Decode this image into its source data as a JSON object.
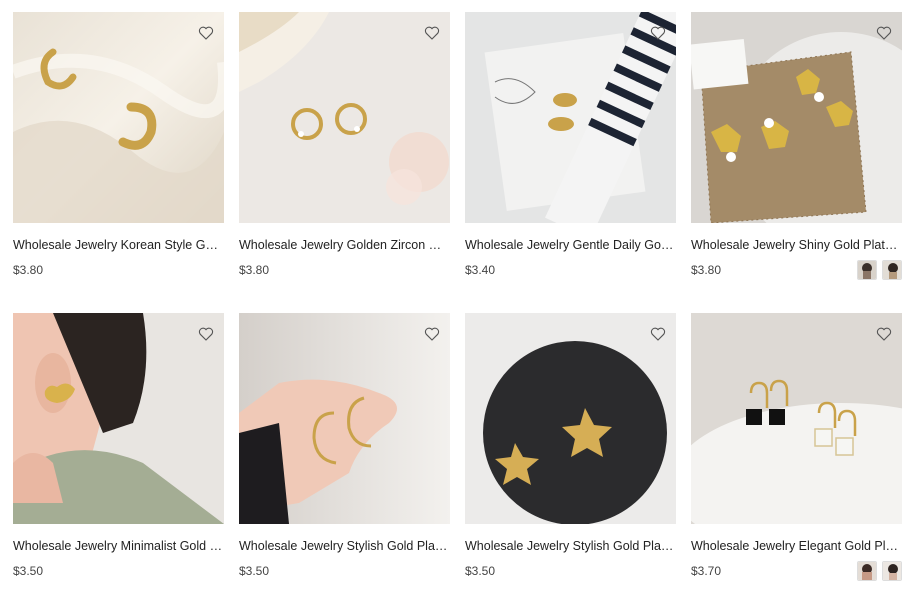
{
  "products": [
    {
      "title": "Wholesale Jewelry Korean Style Gold Plated Earrings",
      "price": "$3.80",
      "favorite_icon": "heart-outline-icon",
      "swatches": []
    },
    {
      "title": "Wholesale Jewelry Golden Zircon Crystal Hoop Earrings",
      "price": "$3.80",
      "favorite_icon": "heart-outline-icon",
      "swatches": []
    },
    {
      "title": "Wholesale Jewelry Gentle Daily Gold Leaf Earrings",
      "price": "$3.40",
      "favorite_icon": "heart-outline-icon",
      "swatches": []
    },
    {
      "title": "Wholesale Jewelry Shiny Gold Plated Heart Earrings",
      "price": "$3.80",
      "favorite_icon": "heart-outline-icon",
      "swatches": [
        "variant-1",
        "variant-2"
      ]
    },
    {
      "title": "Wholesale Jewelry Minimalist Gold Heart Earrings",
      "price": "$3.50",
      "favorite_icon": "heart-outline-icon",
      "swatches": []
    },
    {
      "title": "Wholesale Jewelry Stylish Gold Plated Moon Earrings",
      "price": "$3.50",
      "favorite_icon": "heart-outline-icon",
      "swatches": []
    },
    {
      "title": "Wholesale Jewelry Stylish Gold Plated Starfish Earrings",
      "price": "$3.50",
      "favorite_icon": "heart-outline-icon",
      "swatches": []
    },
    {
      "title": "Wholesale Jewelry Elegant Gold Plated Square Earrings",
      "price": "$3.70",
      "favorite_icon": "heart-outline-icon",
      "swatches": [
        "variant-1",
        "variant-2"
      ]
    }
  ],
  "colors": {
    "gold": "#c9a24a",
    "text": "#222222",
    "price": "#444444"
  }
}
